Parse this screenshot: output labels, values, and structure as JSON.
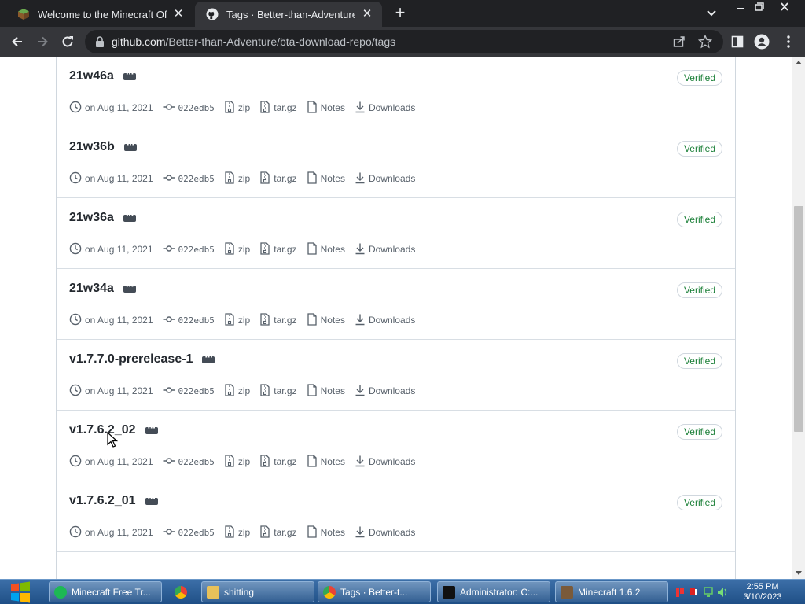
{
  "browser": {
    "tabs": [
      {
        "title": "Welcome to the Minecraft Official",
        "active": false
      },
      {
        "title": "Tags · Better-than-Adventure/bta-download-repo",
        "active": true
      }
    ],
    "url_host": "github.com",
    "url_path": "/Better-than-Adventure/bta-download-repo/tags"
  },
  "labels": {
    "verified": "Verified",
    "zip": "zip",
    "targz": "tar.gz",
    "notes": "Notes",
    "downloads": "Downloads"
  },
  "tags": [
    {
      "name": "21w46a",
      "date": "on Aug 11, 2021",
      "commit": "022edb5"
    },
    {
      "name": "21w46a",
      "date": "on Aug 11, 2021",
      "commit": "022edb5"
    },
    {
      "name": "21w36b",
      "date": "on Aug 11, 2021",
      "commit": "022edb5"
    },
    {
      "name": "21w36a",
      "date": "on Aug 11, 2021",
      "commit": "022edb5"
    },
    {
      "name": "21w34a",
      "date": "on Aug 11, 2021",
      "commit": "022edb5"
    },
    {
      "name": "v1.7.7.0-prerelease-1",
      "date": "on Aug 11, 2021",
      "commit": "022edb5"
    },
    {
      "name": "v1.7.6.2_02",
      "date": "on Aug 11, 2021",
      "commit": "022edb5"
    },
    {
      "name": "v1.7.6.2_01",
      "date": "on Aug 11, 2021",
      "commit": "022edb5"
    }
  ],
  "taskbar": {
    "items": [
      {
        "label": "Minecraft Free Tr...",
        "icon": "spotify-icon",
        "color": "#1db954"
      },
      {
        "label": "",
        "icon": "chrome-icon",
        "color": "#4285f4"
      },
      {
        "label": "shitting",
        "icon": "folder-icon",
        "color": "#e8c15a"
      },
      {
        "label": "Tags · Better-t...",
        "icon": "chrome-icon",
        "color": "#4285f4"
      },
      {
        "label": "Administrator: C:...",
        "icon": "cmd-icon",
        "color": "#111111"
      },
      {
        "label": "Minecraft 1.6.2",
        "icon": "minecraft-icon",
        "color": "#7a5a3a"
      }
    ],
    "time": "2:55 PM",
    "date": "3/10/2023"
  }
}
